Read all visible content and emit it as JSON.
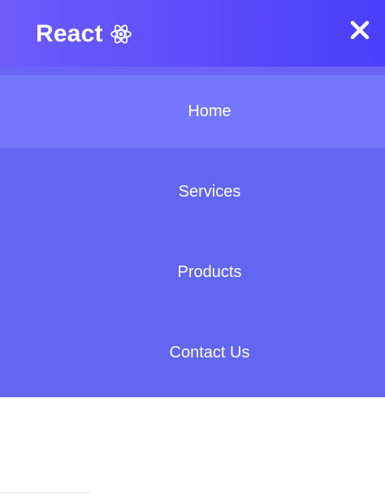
{
  "brand": {
    "title": "React",
    "icon": "react-atom-icon"
  },
  "navbar": {
    "close_icon": "close-icon",
    "gradient_start": "#6d5cfb",
    "gradient_end": "#4a3ffa"
  },
  "menu": {
    "background": "#6366f1",
    "active_background": "#7477fc",
    "items": [
      {
        "label": "Home",
        "active": true
      },
      {
        "label": "Services",
        "active": false
      },
      {
        "label": "Products",
        "active": false
      },
      {
        "label": "Contact Us",
        "active": false
      }
    ]
  }
}
